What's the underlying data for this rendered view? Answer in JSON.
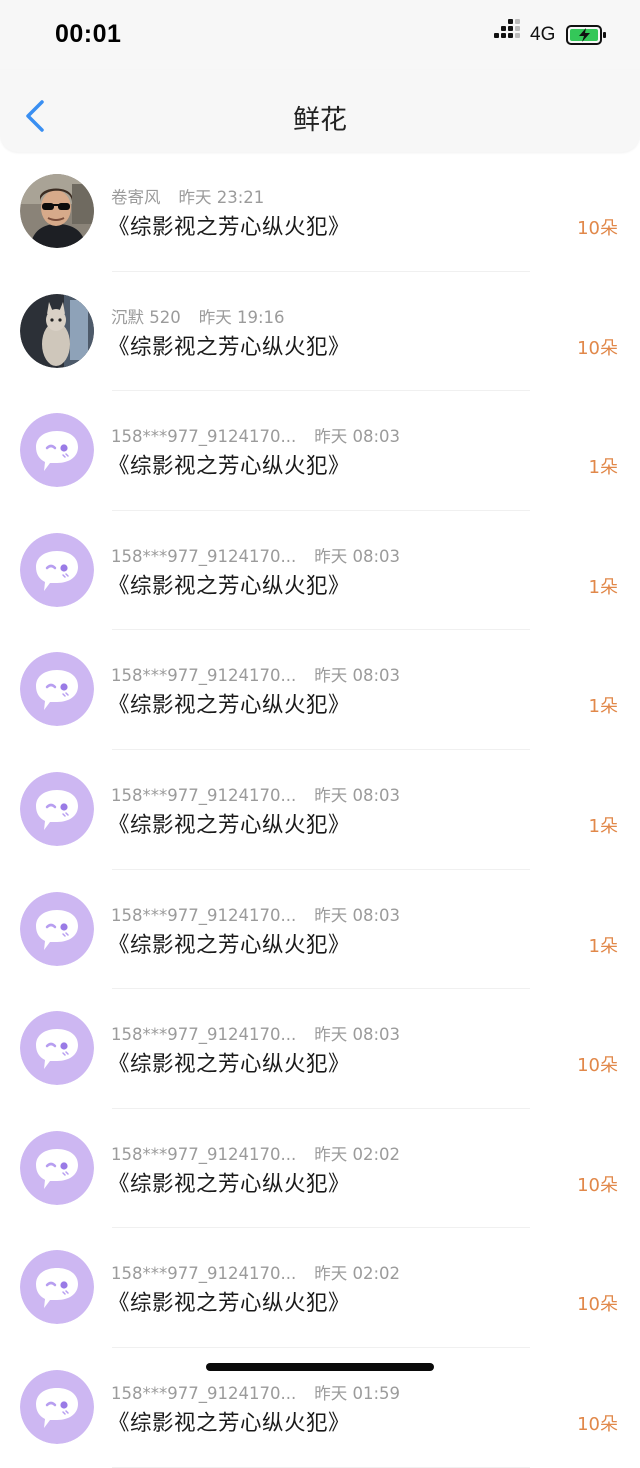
{
  "status_bar": {
    "time": "00:01",
    "network": "4G",
    "icons": [
      "signal-icon",
      "battery-charging-icon"
    ]
  },
  "navbar": {
    "title": "鲜花",
    "back_icon": "chevron-left-icon",
    "accent": "#3a8ff2"
  },
  "colors": {
    "count": "#e1884a",
    "avatar_default": "#cdb7f2"
  },
  "rows": [
    {
      "name": "卷寄风",
      "time": "昨天 23:21",
      "book": "《综影视之芳心纵火犯》",
      "count": "10朵",
      "avatar": "photo-man-sunglasses"
    },
    {
      "name": "沉默 520",
      "time": "昨天 19:16",
      "book": "《综影视之芳心纵火犯》",
      "count": "10朵",
      "avatar": "photo-cat"
    },
    {
      "name": "158***977_9124170...",
      "time": "昨天 08:03",
      "book": "《综影视之芳心纵火犯》",
      "count": "1朵",
      "avatar": "default-chat-bubble-icon"
    },
    {
      "name": "158***977_9124170...",
      "time": "昨天 08:03",
      "book": "《综影视之芳心纵火犯》",
      "count": "1朵",
      "avatar": "default-chat-bubble-icon"
    },
    {
      "name": "158***977_9124170...",
      "time": "昨天 08:03",
      "book": "《综影视之芳心纵火犯》",
      "count": "1朵",
      "avatar": "default-chat-bubble-icon"
    },
    {
      "name": "158***977_9124170...",
      "time": "昨天 08:03",
      "book": "《综影视之芳心纵火犯》",
      "count": "1朵",
      "avatar": "default-chat-bubble-icon"
    },
    {
      "name": "158***977_9124170...",
      "time": "昨天 08:03",
      "book": "《综影视之芳心纵火犯》",
      "count": "1朵",
      "avatar": "default-chat-bubble-icon"
    },
    {
      "name": "158***977_9124170...",
      "time": "昨天 08:03",
      "book": "《综影视之芳心纵火犯》",
      "count": "10朵",
      "avatar": "default-chat-bubble-icon"
    },
    {
      "name": "158***977_9124170...",
      "time": "昨天 02:02",
      "book": "《综影视之芳心纵火犯》",
      "count": "10朵",
      "avatar": "default-chat-bubble-icon"
    },
    {
      "name": "158***977_9124170...",
      "time": "昨天 02:02",
      "book": "《综影视之芳心纵火犯》",
      "count": "10朵",
      "avatar": "default-chat-bubble-icon"
    },
    {
      "name": "158***977_9124170...",
      "time": "昨天 01:59",
      "book": "《综影视之芳心纵火犯》",
      "count": "10朵",
      "avatar": "default-chat-bubble-icon"
    }
  ]
}
